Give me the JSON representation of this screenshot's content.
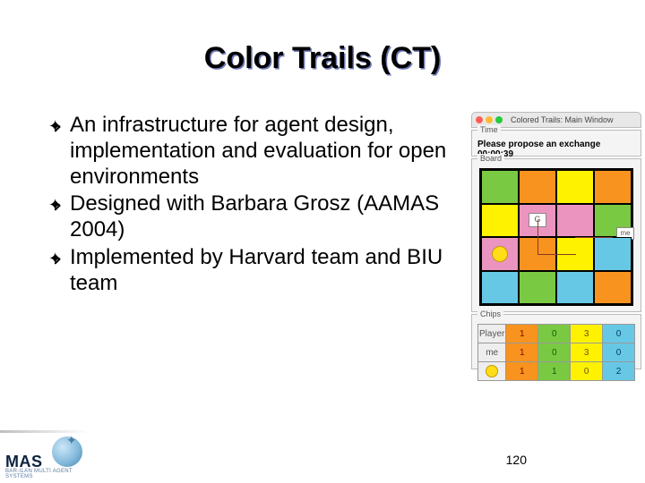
{
  "title": "Color Trails (CT)",
  "bullets": [
    "An infrastructure for agent design, implementation and evaluation for open environments",
    "Designed with Barbara Grosz (AAMAS 2004)",
    "Implemented by Harvard team and BIU team"
  ],
  "page_number": "120",
  "app": {
    "window_title": "Colored Trails: Main Window",
    "time_label": "Time",
    "time_text": "Please propose an exchange 00:00:39",
    "board_label": "Board",
    "token_goal": "G",
    "token_me": "me",
    "chips_label": "Chips",
    "chips_header": "Player",
    "chips_rows": [
      {
        "player": "me",
        "values": [
          "1",
          "0",
          "3",
          "0"
        ]
      },
      {
        "player": "sun",
        "values": [
          "1",
          "1",
          "0",
          "2"
        ]
      }
    ]
  },
  "logo": {
    "text": "MAS",
    "subtitle": "BAR-ILAN   MULTI AGENT SYSTEMS"
  }
}
